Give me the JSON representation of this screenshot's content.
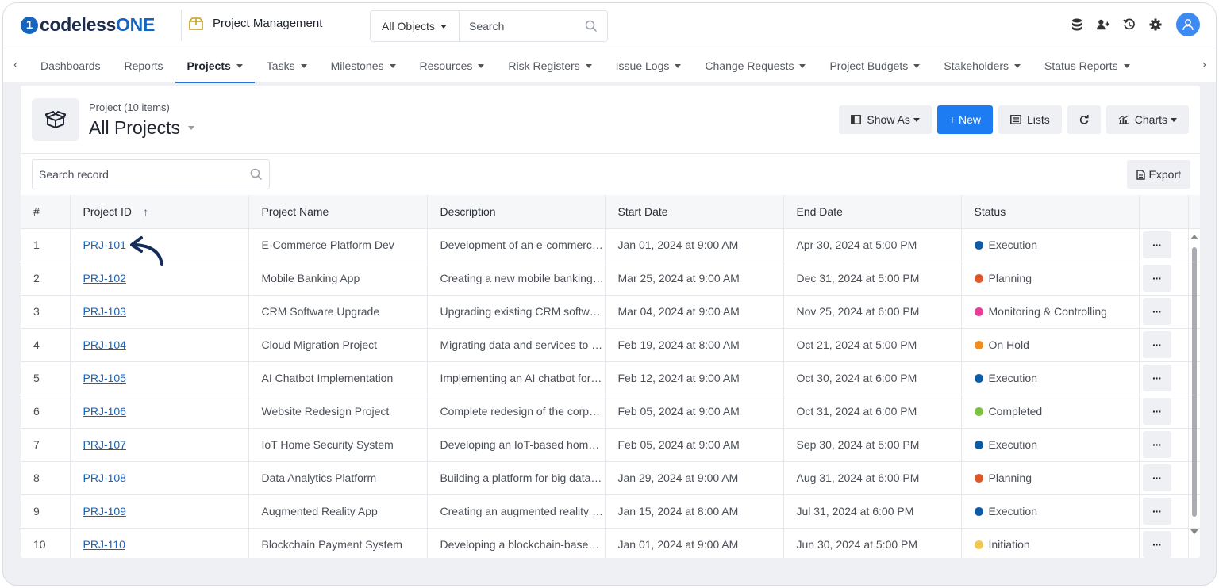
{
  "brand": {
    "logo_mark": "1",
    "logo_text_a": "codeless",
    "logo_text_b": "ONE"
  },
  "app": {
    "name": "Project Management",
    "icon": "package-icon"
  },
  "global_search": {
    "scope": "All Objects",
    "placeholder": "Search"
  },
  "top_icons": [
    "database-icon",
    "add-user-icon",
    "history-icon",
    "gear-icon",
    "user-avatar-icon"
  ],
  "nav": {
    "items": [
      {
        "label": "Dashboards",
        "dropdown": false
      },
      {
        "label": "Reports",
        "dropdown": false
      },
      {
        "label": "Projects",
        "dropdown": true,
        "active": true
      },
      {
        "label": "Tasks",
        "dropdown": true
      },
      {
        "label": "Milestones",
        "dropdown": true
      },
      {
        "label": "Resources",
        "dropdown": true
      },
      {
        "label": "Risk Registers",
        "dropdown": true
      },
      {
        "label": "Issue Logs",
        "dropdown": true
      },
      {
        "label": "Change Requests",
        "dropdown": true
      },
      {
        "label": "Project Budgets",
        "dropdown": true
      },
      {
        "label": "Stakeholders",
        "dropdown": true
      },
      {
        "label": "Status Reports",
        "dropdown": true
      }
    ]
  },
  "header": {
    "subtitle": "Project (10 items)",
    "title": "All Projects",
    "buttons": {
      "show_as": "Show As",
      "new": "+ New",
      "lists": "Lists",
      "charts": "Charts"
    }
  },
  "toolbar": {
    "search_placeholder": "Search record",
    "export": "Export"
  },
  "table": {
    "columns": [
      "#",
      "Project ID",
      "Project Name",
      "Description",
      "Start Date",
      "End Date",
      "Status"
    ],
    "sort_indicator": "↑",
    "rows": [
      {
        "n": "1",
        "id": "PRJ-101",
        "name": "E-Commerce Platform Dev",
        "desc": "Development of an e-commerce platform",
        "start": "Jan 01, 2024 at 9:00 AM",
        "end": "Apr 30, 2024 at 5:00 PM",
        "status": "Execution",
        "color": "#0d5aa7"
      },
      {
        "n": "2",
        "id": "PRJ-102",
        "name": "Mobile Banking App",
        "desc": "Creating a new mobile banking application",
        "start": "Mar 25, 2024 at 9:00 AM",
        "end": "Dec 31, 2024 at 5:00 PM",
        "status": "Planning",
        "color": "#e0562b"
      },
      {
        "n": "3",
        "id": "PRJ-103",
        "name": "CRM Software Upgrade",
        "desc": "Upgrading existing CRM software",
        "start": "Mar 04, 2024 at 9:00 AM",
        "end": "Nov 25, 2024 at 6:00 PM",
        "status": "Monitoring & Controlling",
        "color": "#e83e9b"
      },
      {
        "n": "4",
        "id": "PRJ-104",
        "name": "Cloud Migration Project",
        "desc": "Migrating data and services to the cloud",
        "start": "Feb 19, 2024 at 8:00 AM",
        "end": "Oct 21, 2024 at 5:00 PM",
        "status": "On Hold",
        "color": "#f28c1c"
      },
      {
        "n": "5",
        "id": "PRJ-105",
        "name": "AI Chatbot Implementation",
        "desc": "Implementing an AI chatbot for support",
        "start": "Feb 12, 2024 at 9:00 AM",
        "end": "Oct 30, 2024 at 6:00 PM",
        "status": "Execution",
        "color": "#0d5aa7"
      },
      {
        "n": "6",
        "id": "PRJ-106",
        "name": "Website Redesign Project",
        "desc": "Complete redesign of the corporate website",
        "start": "Feb 05, 2024 at 9:00 AM",
        "end": "Oct 31, 2024 at 6:00 PM",
        "status": "Completed",
        "color": "#7cc242"
      },
      {
        "n": "7",
        "id": "PRJ-107",
        "name": "IoT Home Security System",
        "desc": "Developing an IoT-based home security system",
        "start": "Feb 05, 2024 at 9:00 AM",
        "end": "Sep 30, 2024 at 5:00 PM",
        "status": "Execution",
        "color": "#0d5aa7"
      },
      {
        "n": "8",
        "id": "PRJ-108",
        "name": "Data Analytics Platform",
        "desc": "Building a platform for big data analytics",
        "start": "Jan 29, 2024 at 9:00 AM",
        "end": "Aug 31, 2024 at 6:00 PM",
        "status": "Planning",
        "color": "#e0562b"
      },
      {
        "n": "9",
        "id": "PRJ-109",
        "name": "Augmented Reality App",
        "desc": "Creating an augmented reality application",
        "start": "Jan 15, 2024 at 8:00 AM",
        "end": "Jul 31, 2024 at 6:00 PM",
        "status": "Execution",
        "color": "#0d5aa7"
      },
      {
        "n": "10",
        "id": "PRJ-110",
        "name": "Blockchain Payment System",
        "desc": "Developing a blockchain-based payment system",
        "start": "Jan 01, 2024 at 9:00 AM",
        "end": "Jun 30, 2024 at 5:00 PM",
        "status": "Initiation",
        "color": "#f2c94c"
      }
    ],
    "row_action": "···"
  },
  "colors": {
    "accent": "#1e7cf2",
    "link": "#1565c0",
    "brand_dark": "#1d2b4f"
  }
}
